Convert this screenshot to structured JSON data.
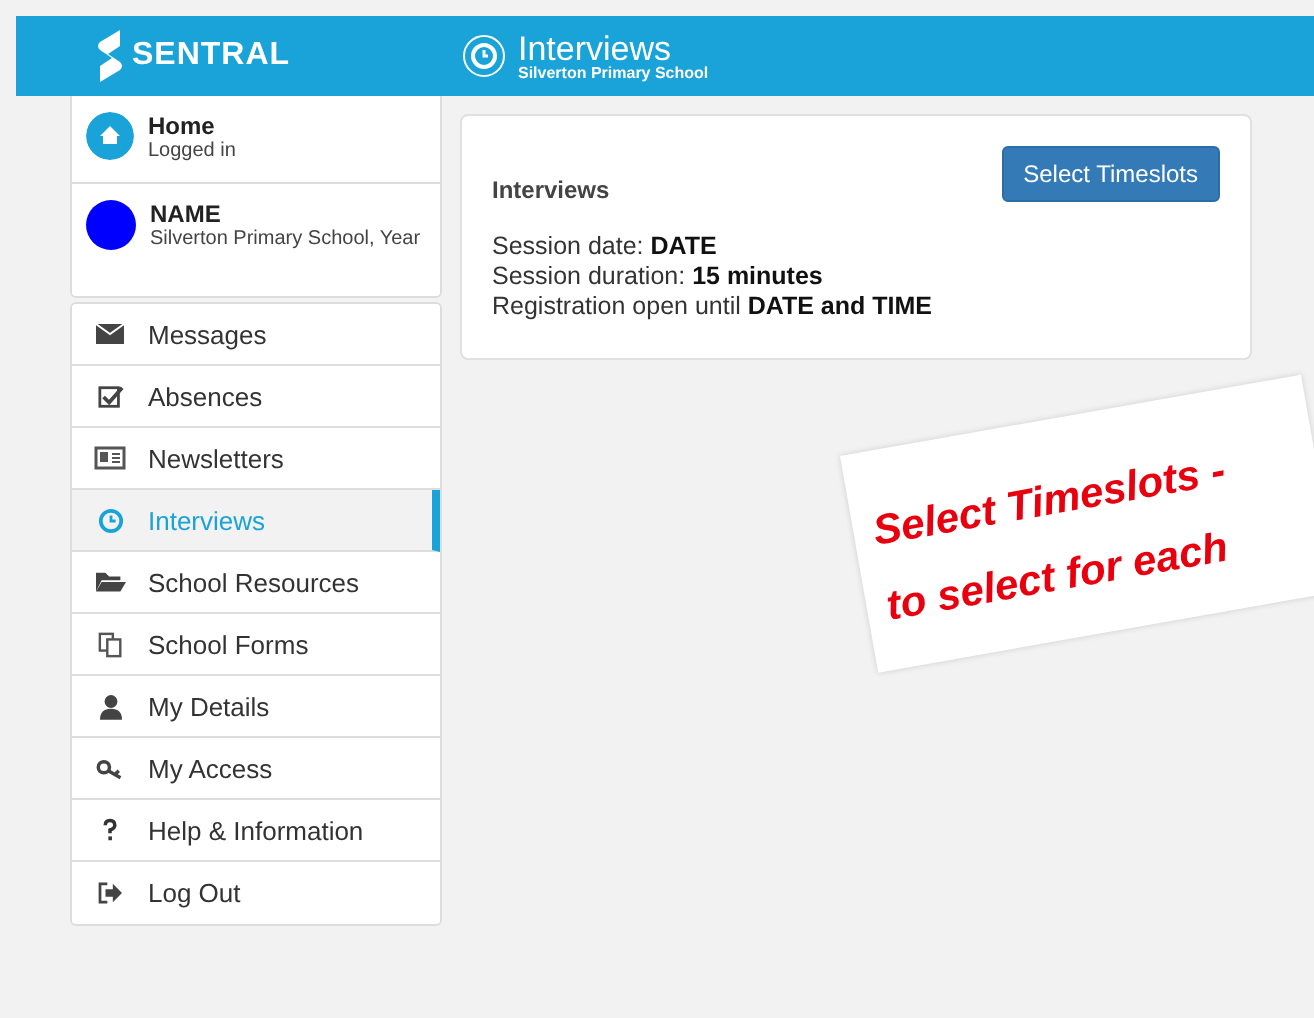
{
  "header": {
    "logo": "SENTRAL",
    "title": "Interviews",
    "subtitle": "Silverton Primary School"
  },
  "profile": [
    {
      "kind": "home",
      "title": "Home",
      "subtitle": "Logged in"
    },
    {
      "kind": "student",
      "title": "NAME",
      "subtitle": "Silverton Primary School, Year"
    }
  ],
  "menu": [
    {
      "label": "Messages",
      "selected": false
    },
    {
      "label": "Absences",
      "selected": false
    },
    {
      "label": "Newsletters",
      "selected": false
    },
    {
      "label": "Interviews",
      "selected": true
    },
    {
      "label": "School Resources",
      "selected": false
    },
    {
      "label": "School Forms",
      "selected": false
    },
    {
      "label": "My Details",
      "selected": false
    },
    {
      "label": "My Access",
      "selected": false
    },
    {
      "label": "Help & Information",
      "selected": false
    },
    {
      "label": "Log Out",
      "selected": false
    }
  ],
  "card": {
    "title": "Interviews",
    "button": "Select Timeslots",
    "lines": [
      "Session date: **DATE**",
      "Session duration: **15 minutes**",
      "Registration open until **DATE and TIME**"
    ]
  },
  "callout": {
    "lines": [
      "Select Timeslots -",
      "to select for each"
    ]
  }
}
